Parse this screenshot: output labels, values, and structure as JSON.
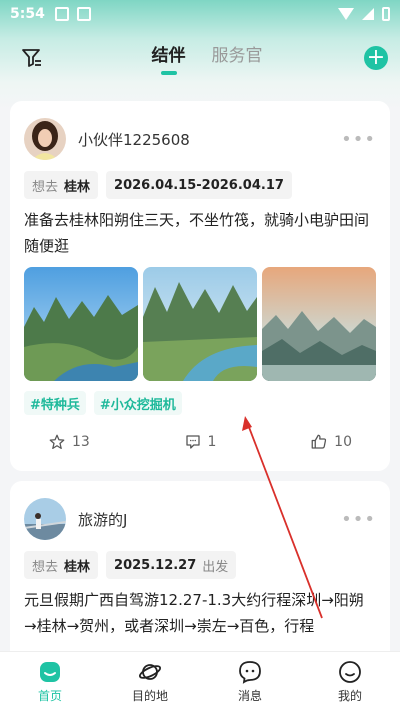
{
  "status_bar": {
    "time": "5:54"
  },
  "header": {
    "tabs": [
      {
        "label": "结伴",
        "active": true
      },
      {
        "label": "服务官",
        "active": false
      }
    ],
    "add_label": "+"
  },
  "posts": [
    {
      "username": "小伙伴1225608",
      "tag_want_label": "想去",
      "destination": "桂林",
      "date_range": "2026.04.15-2026.04.17",
      "description": "准备去桂林阳朔住三天，不坐竹筏，就骑小电驴田间随便逛",
      "hashtags": [
        "#特种兵",
        "#小众挖掘机"
      ],
      "stats": {
        "stars": "13",
        "comments": "1",
        "likes": "10"
      }
    },
    {
      "username": "旅游的J",
      "tag_want_label": "想去",
      "destination": "桂林",
      "date": "2025.12.27",
      "date_suffix": "出发",
      "description": "元旦假期广西自驾游12.27-1.3大约行程深圳→阳朔→桂林→贺州，或者深圳→崇左→百色，行程"
    }
  ],
  "bottom_nav": [
    {
      "label": "首页",
      "icon": "home-icon",
      "active": true
    },
    {
      "label": "目的地",
      "icon": "planet-icon",
      "active": false
    },
    {
      "label": "消息",
      "icon": "message-icon",
      "active": false
    },
    {
      "label": "我的",
      "icon": "profile-icon",
      "active": false
    }
  ],
  "colors": {
    "accent": "#1fc3a4",
    "annotation_arrow": "#d9302b"
  }
}
